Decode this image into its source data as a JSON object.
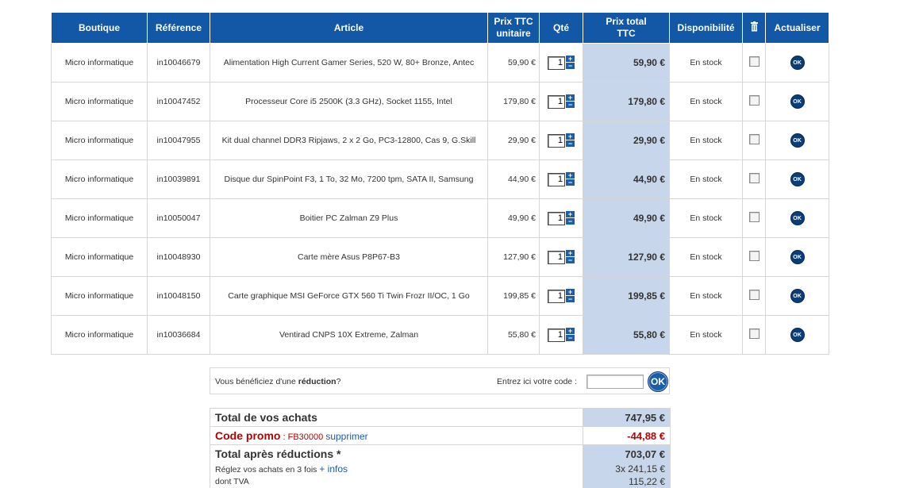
{
  "headers": {
    "boutique": "Boutique",
    "reference": "Référence",
    "article": "Article",
    "prix_unitaire_1": "Prix TTC",
    "prix_unitaire_2": "unitaire",
    "qte": "Qté",
    "prix_total_1": "Prix total",
    "prix_total_2": "TTC",
    "disponibilite": "Disponibilité",
    "actualiser": "Actualiser"
  },
  "rows": [
    {
      "boutique": "Micro informatique",
      "ref": "in10046679",
      "article": "Alimentation High Current Gamer Series, 520 W, 80+ Bronze, Antec",
      "unit": "59,90 €",
      "qty": "1",
      "total": "59,90 €",
      "stock": "En stock",
      "ok": "OK"
    },
    {
      "boutique": "Micro informatique",
      "ref": "in10047452",
      "article": "Processeur Core i5 2500K (3.3 GHz), Socket 1155, Intel",
      "unit": "179,80 €",
      "qty": "1",
      "total": "179,80 €",
      "stock": "En stock",
      "ok": "OK"
    },
    {
      "boutique": "Micro informatique",
      "ref": "in10047955",
      "article": "Kit dual channel DDR3 Ripjaws, 2 x 2 Go, PC3-12800, Cas 9, G.Skill",
      "unit": "29,90 €",
      "qty": "1",
      "total": "29,90 €",
      "stock": "En stock",
      "ok": "OK"
    },
    {
      "boutique": "Micro informatique",
      "ref": "in10039891",
      "article": "Disque dur SpinPoint F3, 1 To, 32 Mo, 7200 tpm, SATA II, Samsung",
      "unit": "44,90 €",
      "qty": "1",
      "total": "44,90 €",
      "stock": "En stock",
      "ok": "OK"
    },
    {
      "boutique": "Micro informatique",
      "ref": "in10050047",
      "article": "Boitier PC Zalman Z9 Plus",
      "unit": "49,90 €",
      "qty": "1",
      "total": "49,90 €",
      "stock": "En stock",
      "ok": "OK"
    },
    {
      "boutique": "Micro informatique",
      "ref": "in10048930",
      "article": "Carte mère Asus P8P67-B3",
      "unit": "127,90 €",
      "qty": "1",
      "total": "127,90 €",
      "stock": "En stock",
      "ok": "OK"
    },
    {
      "boutique": "Micro informatique",
      "ref": "in10048150",
      "article": "Carte graphique MSI GeForce GTX 560 Ti Twin Frozr II/OC, 1 Go",
      "unit": "199,85 €",
      "qty": "1",
      "total": "199,85 €",
      "stock": "En stock",
      "ok": "OK"
    },
    {
      "boutique": "Micro informatique",
      "ref": "in10036684",
      "article": "Ventirad CNPS 10X Extreme, Zalman",
      "unit": "55,80 €",
      "qty": "1",
      "total": "55,80 €",
      "stock": "En stock",
      "ok": "OK"
    }
  ],
  "qty_plus": "+",
  "qty_minus": "−",
  "promo": {
    "text_before": "Vous bénéficiez d'une ",
    "text_bold": "réduction",
    "text_after": "?",
    "code_label": "Entrez ici votre code :",
    "code_value": "",
    "ok_label": "OK"
  },
  "totals": {
    "total_label": "Total de vos achats",
    "total_value": "747,95 €",
    "promo_label": "Code promo",
    "promo_code": " : FB30000 ",
    "promo_remove": "supprimer",
    "promo_value": "-44,88 €",
    "after_label": "Total après réductions *",
    "after_value": "703,07 €",
    "installments_label": "Réglez vos achats en 3 fois ",
    "installments_link": "+ infos",
    "installments_value": "3x  241,15 €",
    "tva_label": "dont TVA",
    "tva_value": "115,22 €"
  },
  "colors": {
    "header": "#1358a6",
    "total_col": "#c7d6ea",
    "promo_red": "#b30000",
    "link": "#1a5da8"
  }
}
